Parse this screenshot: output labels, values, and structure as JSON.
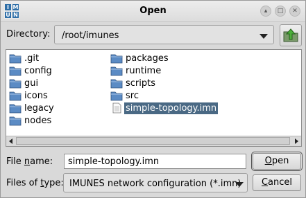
{
  "window": {
    "title": "Open",
    "app_icon_letters": [
      "I",
      "M",
      "U",
      "N"
    ]
  },
  "wm_buttons": {
    "shade": "▴",
    "maximize": "□",
    "close": "✕"
  },
  "directory": {
    "label": "Directory:",
    "value": "/root/imunes"
  },
  "files": {
    "column1": [
      {
        "name": ".git",
        "icon": "folder-icon"
      },
      {
        "name": "config",
        "icon": "folder-icon"
      },
      {
        "name": "gui",
        "icon": "folder-icon"
      },
      {
        "name": "icons",
        "icon": "folder-icon"
      },
      {
        "name": "legacy",
        "icon": "folder-icon"
      },
      {
        "name": "nodes",
        "icon": "folder-icon"
      }
    ],
    "column2": [
      {
        "name": "packages",
        "icon": "folder-icon"
      },
      {
        "name": "runtime",
        "icon": "folder-icon"
      },
      {
        "name": "scripts",
        "icon": "folder-icon"
      },
      {
        "name": "src",
        "icon": "folder-icon"
      },
      {
        "name": "simple-topology.imn",
        "icon": "file-icon",
        "selected": true
      }
    ]
  },
  "filename": {
    "label_pre": "File ",
    "label_underlined": "n",
    "label_post": "ame:",
    "value": "simple-topology.imn"
  },
  "filetype": {
    "label_pre": "Files of ",
    "label_underlined": "t",
    "label_post": "ype:",
    "value": "IMUNES network configuration (*.imn)"
  },
  "buttons": {
    "open_underlined": "O",
    "open_rest": "pen",
    "cancel_underlined": "C",
    "cancel_rest": "ancel"
  },
  "colors": {
    "selection": "#4a6984",
    "folder": "#5b8bc4"
  }
}
